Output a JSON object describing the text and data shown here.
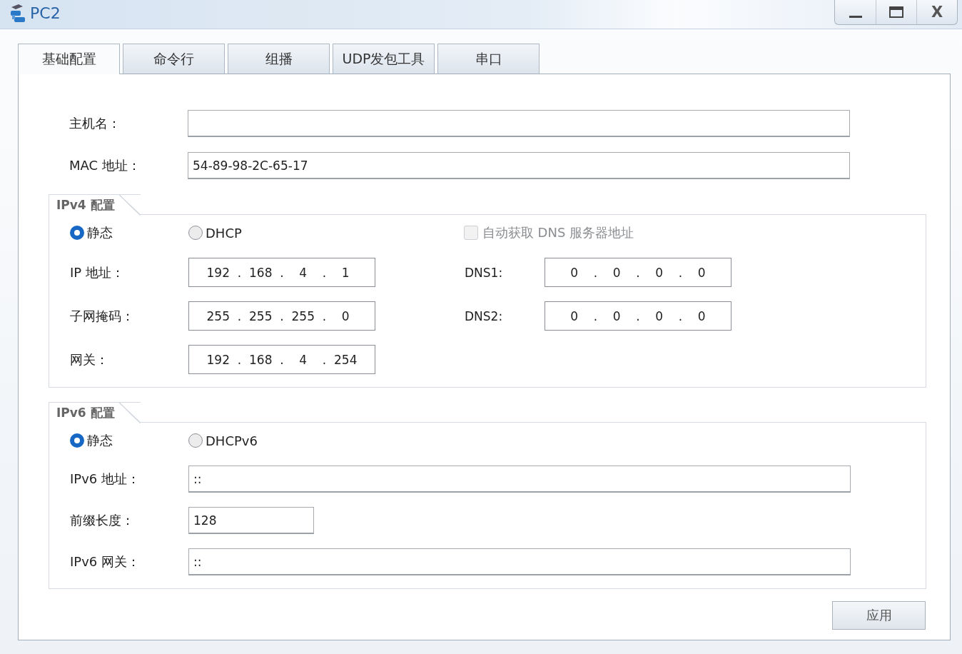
{
  "window": {
    "title": "PC2",
    "close_label": "X"
  },
  "tabs": [
    {
      "label": "基础配置",
      "selected": true
    },
    {
      "label": "命令行",
      "selected": false
    },
    {
      "label": "组播",
      "selected": false
    },
    {
      "label": "UDP发包工具",
      "selected": false
    },
    {
      "label": "串口",
      "selected": false
    }
  ],
  "host": {
    "hostname": {
      "label": "主机名："
    },
    "mac": {
      "label": "MAC 地址：",
      "value": "54-89-98-2C-65-17"
    }
  },
  "ipv4": {
    "title": "IPv4 配置",
    "modes": [
      {
        "label": "静态",
        "selected": true
      },
      {
        "label": "DHCP",
        "selected": false
      }
    ],
    "auto_dns": {
      "label": "自动获取 DNS 服务器地址",
      "checked": false,
      "disabled": true
    },
    "fields": [
      {
        "label": "IP 地址：",
        "parts": [
          "192",
          ".",
          "168",
          ".",
          "4",
          ".",
          "1"
        ]
      },
      {
        "label": "子网掩码：",
        "parts": [
          "255",
          ".",
          "255",
          ".",
          "255",
          ".",
          "0"
        ]
      },
      {
        "label": "网关：",
        "parts": [
          "192",
          ".",
          "168",
          ".",
          "4",
          ".",
          "254"
        ]
      }
    ],
    "dns": [
      {
        "label": "DNS1:",
        "parts": [
          "0",
          ".",
          "0",
          ".",
          "0",
          ".",
          "0"
        ]
      },
      {
        "label": "DNS2:",
        "parts": [
          "0",
          ".",
          "0",
          ".",
          "0",
          ".",
          "0"
        ]
      }
    ]
  },
  "ipv6": {
    "title": "IPv6 配置",
    "modes": [
      {
        "label": "静态",
        "selected": true
      },
      {
        "label": "DHCPv6",
        "selected": false
      }
    ],
    "fields": [
      {
        "label": "IPv6 地址：",
        "value": "::",
        "kind": "wide"
      },
      {
        "label": "前缀长度：",
        "value": "128",
        "kind": "short"
      },
      {
        "label": "IPv6 网关：",
        "value": "::",
        "kind": "wide"
      }
    ]
  },
  "apply_button": "应用"
}
